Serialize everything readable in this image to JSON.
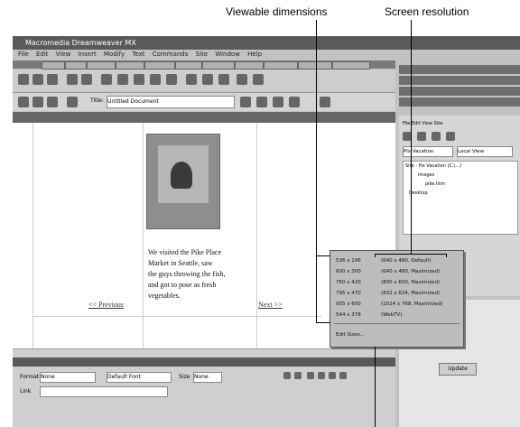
{
  "callouts": {
    "left": "Viewable dimensions",
    "right": "Screen resolution"
  },
  "window": {
    "title": "Macromedia Dreamweaver MX",
    "menu": [
      "File",
      "Edit",
      "View",
      "Insert",
      "Modify",
      "Text",
      "Commands",
      "Site",
      "Window",
      "Help"
    ],
    "doc_title_label": "Title:",
    "doc_title_value": "Untitled Document"
  },
  "document": {
    "paragraph_lines": [
      "We visited the Pike Place",
      "Market in Seattle, saw",
      "the guys throwing the fish,",
      "and got to pose as fresh",
      "vegetables."
    ],
    "prev_link": "<< Previous",
    "next_link": "Next >>"
  },
  "size_menu": {
    "items": [
      {
        "dims": "536 x 196",
        "res": "(640 x 480, Default)"
      },
      {
        "dims": "600 x 300",
        "res": "(640 x 480, Maximized)"
      },
      {
        "dims": "760 x 420",
        "res": "(800 x 600, Maximized)"
      },
      {
        "dims": "795 x 470",
        "res": "(832 x 624, Maximized)"
      },
      {
        "dims": "955 x 600",
        "res": "(1024 x 768, Maximized)"
      },
      {
        "dims": "544 x 378",
        "res": "(WebTV)"
      }
    ],
    "edit_sizes": "Edit Sizes..."
  },
  "site_panel": {
    "site_select": "Pix Vacation",
    "view_select": "Local View",
    "tree": [
      "Site - Pix Vacation (C:\\...)",
      "images",
      "pike.htm",
      "Desktop"
    ],
    "update_button": "Update"
  },
  "property_inspector": {
    "format_label": "Format",
    "format_value": "None",
    "link_label": "Link",
    "default_font": "Default Font",
    "size_label": "Size",
    "size_value": "None"
  }
}
